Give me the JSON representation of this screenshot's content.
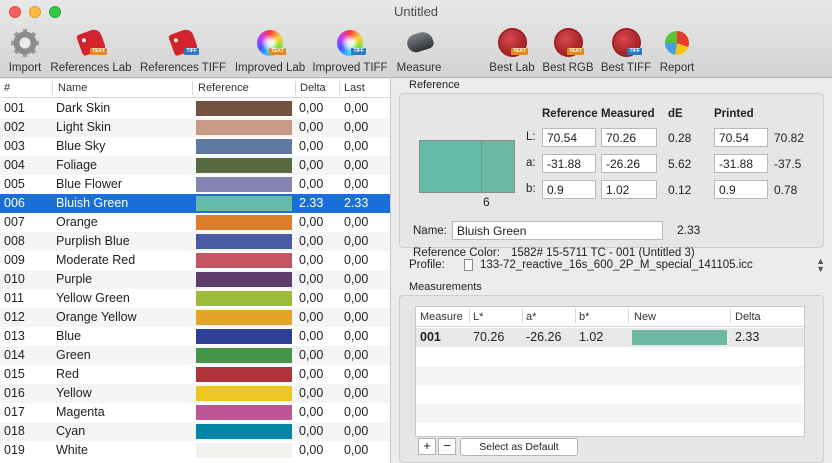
{
  "window": {
    "title": "Untitled"
  },
  "toolbar": [
    {
      "label": "Import",
      "icon": "gear-icon"
    },
    {
      "label": "References Lab",
      "icon": "tag-text-icon"
    },
    {
      "label": "References TIFF",
      "icon": "tag-tiff-icon"
    },
    {
      "label": "Improved Lab",
      "icon": "color-wheel-icon"
    },
    {
      "label": "Improved TIFF",
      "icon": "color-wheel-tiff-icon"
    },
    {
      "label": "Measure",
      "icon": "spectrophotometer-icon"
    },
    {
      "label": "Best Lab",
      "icon": "seal-text-icon"
    },
    {
      "label": "Best RGB",
      "icon": "seal-text-icon"
    },
    {
      "label": "Best TIFF",
      "icon": "seal-tiff-icon"
    },
    {
      "label": "Report",
      "icon": "pie-chart-icon"
    }
  ],
  "badges": {
    "text": "TEXT",
    "tiff": "TIFF"
  },
  "table": {
    "headers": [
      "#",
      "Name",
      "Reference",
      "Delta",
      "Last"
    ],
    "rows": [
      {
        "num": "001",
        "name": "Dark Skin",
        "color": "#73523f",
        "delta": "0,00",
        "last": "0,00"
      },
      {
        "num": "002",
        "name": "Light Skin",
        "color": "#c79a83",
        "delta": "0,00",
        "last": "0,00"
      },
      {
        "num": "003",
        "name": "Blue Sky",
        "color": "#5f7aa0",
        "delta": "0,00",
        "last": "0,00"
      },
      {
        "num": "004",
        "name": "Foliage",
        "color": "#586a3f",
        "delta": "0,00",
        "last": "0,00"
      },
      {
        "num": "005",
        "name": "Blue Flower",
        "color": "#8583b1",
        "delta": "0,00",
        "last": "0,00"
      },
      {
        "num": "006",
        "name": "Bluish Green",
        "color": "#64bba7",
        "delta": "2.33",
        "last": "2.33"
      },
      {
        "num": "007",
        "name": "Orange",
        "color": "#db7d2a",
        "delta": "0,00",
        "last": "0,00"
      },
      {
        "num": "008",
        "name": "Purplish Blue",
        "color": "#4a5ba5",
        "delta": "0,00",
        "last": "0,00"
      },
      {
        "num": "009",
        "name": "Moderate Red",
        "color": "#c65563",
        "delta": "0,00",
        "last": "0,00"
      },
      {
        "num": "010",
        "name": "Purple",
        "color": "#5d3c6b",
        "delta": "0,00",
        "last": "0,00"
      },
      {
        "num": "011",
        "name": "Yellow Green",
        "color": "#9dbb3b",
        "delta": "0,00",
        "last": "0,00"
      },
      {
        "num": "012",
        "name": "Orange Yellow",
        "color": "#e3a528",
        "delta": "0,00",
        "last": "0,00"
      },
      {
        "num": "013",
        "name": "Blue",
        "color": "#2f3f95",
        "delta": "0,00",
        "last": "0,00"
      },
      {
        "num": "014",
        "name": "Green",
        "color": "#45964a",
        "delta": "0,00",
        "last": "0,00"
      },
      {
        "num": "015",
        "name": "Red",
        "color": "#b0333a",
        "delta": "0,00",
        "last": "0,00"
      },
      {
        "num": "016",
        "name": "Yellow",
        "color": "#ecc71f",
        "delta": "0,00",
        "last": "0,00"
      },
      {
        "num": "017",
        "name": "Magenta",
        "color": "#bd5596",
        "delta": "0,00",
        "last": "0,00"
      },
      {
        "num": "018",
        "name": "Cyan",
        "color": "#0087a5",
        "delta": "0,00",
        "last": "0,00"
      },
      {
        "num": "019",
        "name": "White",
        "color": "#f2f2ee",
        "delta": "0,00",
        "last": "0,00"
      }
    ]
  },
  "reference": {
    "section_title": "Reference",
    "patch_number": "6",
    "patch_ref_color": "#64bba7",
    "patch_meas_color": "#6cb8a2",
    "columns": {
      "reference": "Reference",
      "measured": "Measured",
      "de": "dE",
      "printed": "Printed"
    },
    "rows": [
      {
        "label": "L:",
        "reference": "70.54",
        "measured": "70.26",
        "de": "0.28",
        "printed": "70.54",
        "printed_value": "70.82"
      },
      {
        "label": "a:",
        "reference": "-31.88",
        "measured": "-26.26",
        "de": "5.62",
        "printed": "-31.88",
        "printed_value": "-37.5"
      },
      {
        "label": "b:",
        "reference": "0.9",
        "measured": "1.02",
        "de": "0.12",
        "printed": "0.9",
        "printed_value": "0.78"
      }
    ],
    "name_label": "Name:",
    "name_value": "Bluish Green",
    "name_de": "2.33",
    "ref_color_label": "Reference Color:",
    "ref_color_value": "1582# 15-5711 TC - 001 (Untitled 3)"
  },
  "profile": {
    "label": "Profile:",
    "value": "133-72_reactive_16s_600_2P_M_special_141105.icc"
  },
  "measurements": {
    "section_title": "Measurements",
    "headers": [
      "Measure",
      "L*",
      "a*",
      "b*",
      "New",
      "Delta"
    ],
    "rows": [
      {
        "measure": "001",
        "l": "70.26",
        "a": "-26.26",
        "b": "1.02",
        "color": "#6cb8a2",
        "delta": "2.33"
      }
    ],
    "add_label": "+",
    "remove_label": "−",
    "default_label": "Select as Default"
  }
}
